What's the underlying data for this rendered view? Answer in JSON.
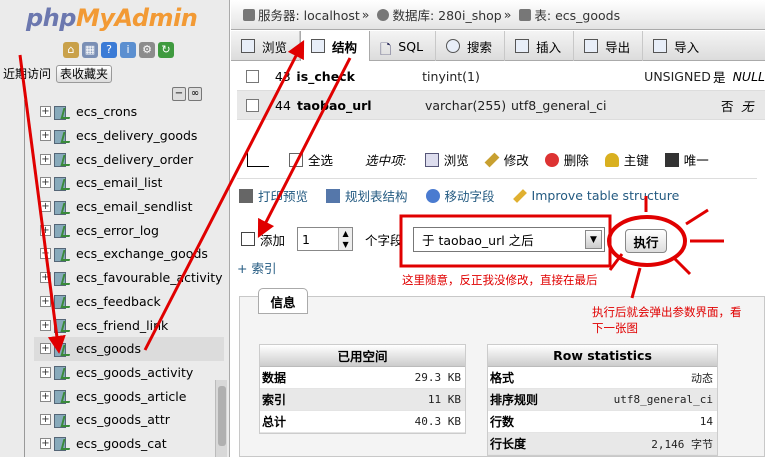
{
  "nav": {
    "logo": {
      "php": "php",
      "my": "My",
      "admin": "Admin"
    },
    "recent_label": "近期访问",
    "favorites_label": "表收藏夹",
    "tables": [
      "ecs_crons",
      "ecs_delivery_goods",
      "ecs_delivery_order",
      "ecs_email_list",
      "ecs_email_sendlist",
      "ecs_error_log",
      "ecs_exchange_goods",
      "ecs_favourable_activity",
      "ecs_feedback",
      "ecs_friend_link",
      "ecs_goods",
      "ecs_goods_activity",
      "ecs_goods_article",
      "ecs_goods_attr",
      "ecs_goods_cat"
    ],
    "active_table": "ecs_goods"
  },
  "breadcrumb": {
    "server_label": "服务器: localhost",
    "sep": "»",
    "db_label": "数据库: 280i_shop",
    "table_label": "表: ecs_goods"
  },
  "tabs": [
    "浏览",
    "结构",
    "SQL",
    "搜索",
    "插入",
    "导出",
    "导入"
  ],
  "columns_rows": [
    {
      "num": "43",
      "name": "is_check",
      "type": "tinyint(1)",
      "collation": "",
      "attr": "UNSIGNED",
      "null": "是",
      "default": "NULL"
    },
    {
      "num": "44",
      "name": "taobao_url",
      "type": "varchar(255)",
      "collation": "utf8_general_ci",
      "attr": "",
      "null": "否",
      "default": "无"
    }
  ],
  "selection_bar": {
    "select_all": "全选",
    "with_selected": "选中项:",
    "actions": [
      "浏览",
      "修改",
      "删除",
      "主键",
      "唯一"
    ]
  },
  "tools": [
    "打印预览",
    "规划表结构",
    "移动字段",
    "Improve table structure"
  ],
  "add_field": {
    "label": "添加",
    "count": "1",
    "unit": "个字段",
    "position_selected": "于 taobao_url 之后",
    "execute": "执行"
  },
  "index_link": "+ 索引",
  "info_tab": "信息",
  "space_usage": {
    "title": "已用空间",
    "rows": [
      {
        "k": "数据",
        "v": "29.3 KB"
      },
      {
        "k": "索引",
        "v": "11 KB"
      },
      {
        "k": "总计",
        "v": "40.3 KB"
      }
    ]
  },
  "row_stats": {
    "title": "Row statistics",
    "rows": [
      {
        "k": "格式",
        "v": "动态"
      },
      {
        "k": "排序规则",
        "v": "utf8_general_ci"
      },
      {
        "k": "行数",
        "v": "14"
      },
      {
        "k": "行长度",
        "v": "2,146 字节"
      }
    ]
  },
  "annotations": {
    "note1": "这里随意，反正我没修改，直接在最后",
    "note2_line1": "执行后就会弹出参数界面，看",
    "note2_line2": "下一张图"
  },
  "colors": {
    "annotation": "#e00000",
    "link": "#235a81"
  }
}
